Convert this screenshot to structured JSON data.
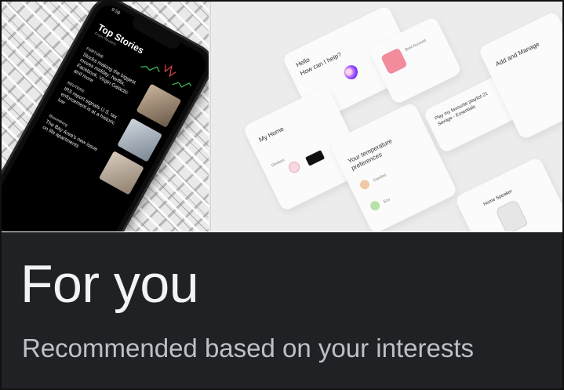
{
  "phone_screen": {
    "status_time": "9:58",
    "title": "Top Stories",
    "subtitle": "From Reuters",
    "stories": [
      {
        "source": "FORTUNE",
        "headline": "Stocks making the biggest moves midday: Netflix, Facebook, Virgin Galactic and more"
      },
      {
        "source": "REUTERS",
        "headline": "IRS report signals U.S. tax enforcement is at a historic low"
      },
      {
        "source": "Bloomberg",
        "headline": "The Bay Area's new issue on life apartments"
      }
    ]
  },
  "home_app": {
    "greeting": "Hello",
    "prompt": "How can I help?",
    "my_home": "My Home",
    "devices_label": "Devices",
    "temperature_card": "Your temperature preferences",
    "comfort": "Comfort",
    "eco": "Eco",
    "media_title": "Best Account",
    "play_prompt": "Play my favourite playlist 21 Savage - Essentials",
    "add_manage": "Add and Manage",
    "speaker": "Home Speaker"
  },
  "panel": {
    "title": "For you",
    "subtitle": "Recommended based on your interests"
  },
  "colors": {
    "panel_bg": "#202124",
    "title": "#f1f3f4",
    "subtitle": "#bdc1c6"
  }
}
